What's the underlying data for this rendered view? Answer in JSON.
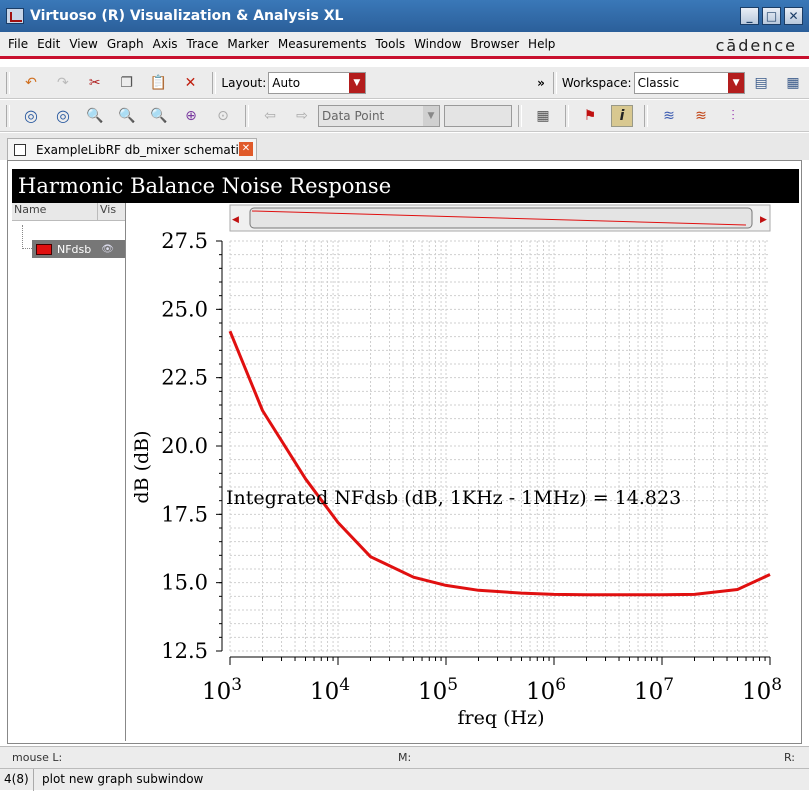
{
  "window": {
    "title": "Virtuoso (R) Visualization & Analysis XL",
    "buttons": [
      "_",
      "□",
      "✕"
    ]
  },
  "menu": {
    "items": [
      "File",
      "Edit",
      "View",
      "Graph",
      "Axis",
      "Trace",
      "Marker",
      "Measurements",
      "Tools",
      "Window",
      "Browser",
      "Help"
    ],
    "brand": "cādence"
  },
  "toolbar": {
    "layout_label": "Layout:",
    "layout_value": "Auto",
    "workspace_label": "Workspace:",
    "workspace_value": "Classic",
    "overflow": "»",
    "marker_mode_value": "Data Point"
  },
  "tab": {
    "label": "ExampleLibRF db_mixer schematic"
  },
  "trace_panel": {
    "col_name": "Name",
    "col_vis": "Vis",
    "traces": [
      {
        "name": "NFdsb",
        "color": "#e01010"
      }
    ]
  },
  "plot": {
    "title": "Harmonic Balance Noise Response",
    "annotation": "Integrated NFdsb (dB, 1KHz - 1MHz) = 14.823"
  },
  "chart_data": {
    "type": "line",
    "title": "Harmonic Balance Noise Response",
    "xlabel": "freq (Hz)",
    "ylabel": "dB (dB)",
    "xscale": "log",
    "xlim": [
      1000,
      100000000
    ],
    "ylim": [
      12.5,
      27.5
    ],
    "x_tick_labels": [
      "10^3",
      "10^4",
      "10^5",
      "10^6",
      "10^7",
      "10^8"
    ],
    "y_tick_labels": [
      "12.5",
      "15.0",
      "17.5",
      "20.0",
      "22.5",
      "25.0",
      "27.5"
    ],
    "grid": true,
    "series": [
      {
        "name": "NFdsb",
        "color": "#e01010",
        "x": [
          1000,
          2000,
          5000,
          10000,
          20000,
          50000,
          100000,
          200000,
          500000,
          1000000,
          2000000,
          5000000,
          10000000,
          20000000,
          50000000,
          100000000
        ],
        "y": [
          24.2,
          21.3,
          18.8,
          17.2,
          15.95,
          15.2,
          14.9,
          14.72,
          14.62,
          14.57,
          14.56,
          14.56,
          14.56,
          14.57,
          14.75,
          15.3
        ]
      }
    ]
  },
  "status": {
    "mouse_l": "mouse L:",
    "mouse_m": "M:",
    "mouse_r": "R:",
    "line_num": "4(8)",
    "message": "plot new graph subwindow"
  }
}
